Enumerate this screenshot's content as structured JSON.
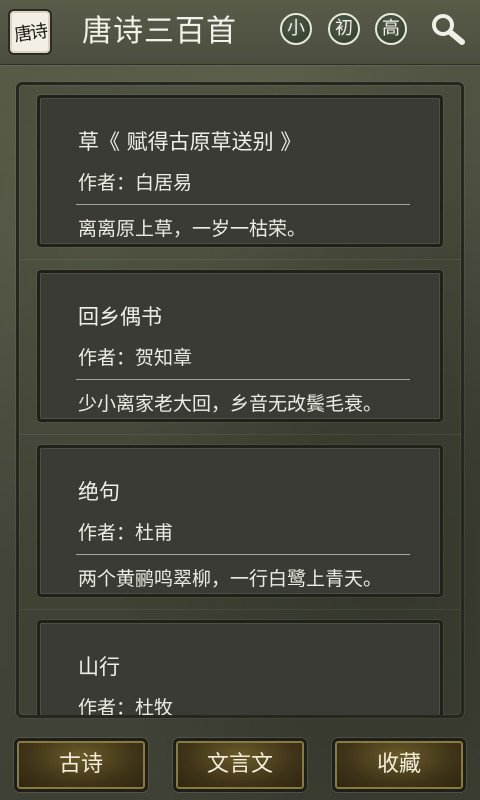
{
  "app": {
    "logo_text": "唐诗",
    "title": "唐诗三百首"
  },
  "levels": [
    "小",
    "初",
    "高"
  ],
  "poems": [
    {
      "title": "草《 赋得古原草送别 》",
      "author": "作者：白居易",
      "line": "离离原上草，一岁一枯荣。"
    },
    {
      "title": "回乡偶书",
      "author": "作者：贺知章",
      "line": "少小离家老大回，乡音无改鬓毛衰。"
    },
    {
      "title": "绝句",
      "author": "作者：杜甫",
      "line": "两个黄鹂鸣翠柳，一行白鹭上青天。"
    },
    {
      "title": "山行",
      "author": "作者：杜牧",
      "line": ""
    }
  ],
  "bottom_nav": [
    "古诗",
    "文言文",
    "收藏"
  ],
  "icons": {
    "search": "search-icon",
    "logo": "app-logo"
  },
  "colors": {
    "background": "#4a4d3d",
    "card": "#3a3b34",
    "text": "#f0f0ea",
    "button_gold": "#6a5a2a"
  }
}
